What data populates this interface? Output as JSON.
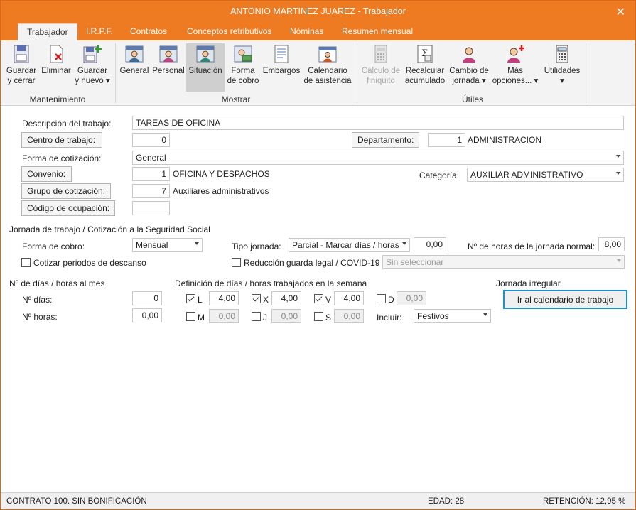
{
  "window": {
    "title": "ANTONIO MARTINEZ JUAREZ - Trabajador",
    "close_glyph": "✕"
  },
  "tabs": [
    "Trabajador",
    "I.R.P.F.",
    "Contratos",
    "Conceptos retributivos",
    "Nóminas",
    "Resumen mensual"
  ],
  "ribbon": {
    "guardar_cerrar": [
      "Guardar",
      "y cerrar"
    ],
    "eliminar": [
      "Eliminar"
    ],
    "guardar_nuevo": [
      "Guardar",
      "y nuevo ▾"
    ],
    "general": [
      "General"
    ],
    "personal": [
      "Personal"
    ],
    "situacion": [
      "Situación"
    ],
    "forma_cobro": [
      "Forma",
      "de cobro"
    ],
    "embargos": [
      "Embargos"
    ],
    "calendario": [
      "Calendario",
      "de asistencia"
    ],
    "calculo_finiquito": [
      "Cálculo de",
      "finiquito"
    ],
    "recalcular": [
      "Recalcular",
      "acumulado"
    ],
    "cambio_jornada": [
      "Cambio de",
      "jornada ▾"
    ],
    "mas_opciones": [
      "Más",
      "opciones... ▾"
    ],
    "utilidades": [
      "Utilidades",
      "▾"
    ],
    "groups": {
      "mantenimiento": "Mantenimiento",
      "mostrar": "Mostrar",
      "utiles": "Útiles"
    }
  },
  "form": {
    "descripcion_label": "Descripción del trabajo:",
    "descripcion_value": "TAREAS DE OFICINA",
    "centro_label": "Centro de trabajo:",
    "centro_value": "0",
    "departamento_label": "Departamento:",
    "departamento_value": "1",
    "departamento_name": "ADMINISTRACION",
    "cotizacion_label": "Forma de cotización:",
    "cotizacion_value": "General",
    "convenio_label": "Convenio:",
    "convenio_value": "1",
    "convenio_name": "OFICINA Y DESPACHOS",
    "categoria_label": "Categoría:",
    "categoria_value": "AUXILIAR ADMINISTRATIVO",
    "grupo_label": "Grupo de cotización:",
    "grupo_value": "7",
    "grupo_name": "Auxiliares administrativos",
    "ocupacion_label": "Código de ocupación:",
    "ocupacion_value": ""
  },
  "jornada": {
    "section_title": "Jornada de trabajo / Cotización a la Seguridad Social",
    "forma_cobro_label": "Forma de cobro:",
    "forma_cobro_value": "Mensual",
    "tipo_jornada_label": "Tipo jornada:",
    "tipo_jornada_value": "Parcial - Marcar días / horas",
    "tipo_jornada_pct": "0,00",
    "horas_normal_label": "Nº de horas de la jornada normal:",
    "horas_normal_value": "8,00",
    "cotizar_label": "Cotizar periodos de descanso",
    "reduccion_label": "Reducción guarda legal / COVID-19",
    "reduccion_select": "Sin seleccionar"
  },
  "dias_horas": {
    "section_title": "Nº de días / horas al mes",
    "dias_label": "Nº días:",
    "dias_value": "0",
    "horas_label": "Nº horas:",
    "horas_value": "0,00"
  },
  "definicion": {
    "section_title": "Definición de días / horas trabajados en la semana",
    "days": [
      {
        "letter": "L",
        "value": "4,00",
        "checked": true
      },
      {
        "letter": "X",
        "value": "4,00",
        "checked": true
      },
      {
        "letter": "V",
        "value": "4,00",
        "checked": true
      },
      {
        "letter": "D",
        "value": "0,00",
        "checked": false
      },
      {
        "letter": "M",
        "value": "0,00",
        "checked": false
      },
      {
        "letter": "J",
        "value": "0,00",
        "checked": false
      },
      {
        "letter": "S",
        "value": "0,00",
        "checked": false
      }
    ],
    "incluir_label": "Incluir:",
    "incluir_value": "Festivos"
  },
  "irregular": {
    "section_title": "Jornada irregular",
    "button": "Ir al calendario de trabajo"
  },
  "status": {
    "contrato": "CONTRATO 100.  SIN BONIFICACIÓN",
    "edad": "EDAD: 28",
    "retencion": "RETENCIÓN: 12,95 %"
  }
}
